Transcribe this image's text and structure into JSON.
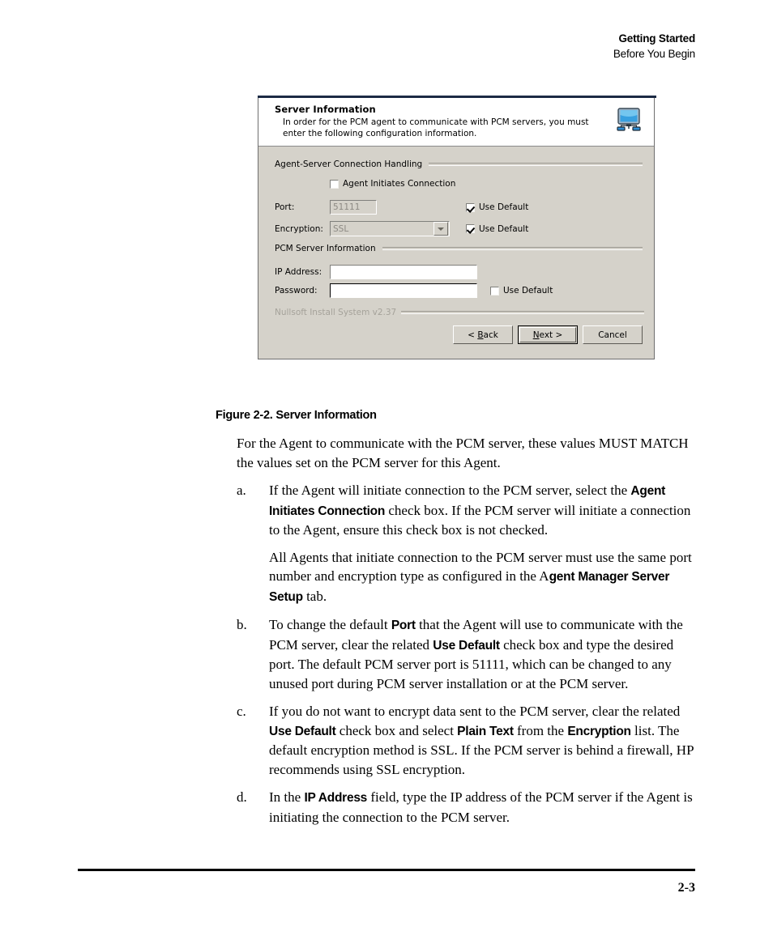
{
  "header": {
    "title": "Getting Started",
    "subtitle": "Before You Begin"
  },
  "dialog": {
    "head_title": "Server Information",
    "head_desc": "In order for the PCM agent to communicate with PCM servers, you must enter the following configuration information.",
    "head_icon": "network-monitor-icon",
    "group_connection": "Agent-Server Connection Handling",
    "agent_initiates_label": "Agent Initiates Connection",
    "agent_initiates_checked": false,
    "port_label": "Port:",
    "port_value": "51111",
    "port_use_default_label": "Use Default",
    "port_use_default_checked": true,
    "encryption_label": "Encryption:",
    "encryption_value": "SSL",
    "encryption_use_default_label": "Use Default",
    "encryption_use_default_checked": true,
    "group_server": "PCM Server Information",
    "ip_label": "IP Address:",
    "ip_value": "",
    "password_label": "Password:",
    "password_value": "",
    "password_use_default_label": "Use Default",
    "password_use_default_checked": false,
    "brand": "Nullsoft Install System v2.37",
    "btn_back": "< Back",
    "btn_back_accel": "B",
    "btn_next": "Next >",
    "btn_next_accel": "N",
    "btn_cancel": "Cancel",
    "accent_icon_color": "#2f8fd6"
  },
  "figure": {
    "caption": "Figure 2-2. Server Information"
  },
  "body": {
    "intro": "For the Agent to communicate with the PCM server, these values MUST MATCH the values set on the PCM server for this Agent.",
    "items": [
      {
        "marker": "a.",
        "paragraphs": [
          {
            "runs": [
              {
                "t": "If the Agent will initiate connection to the PCM server, select the ",
                "b": false
              },
              {
                "t": "Agent Initiates Connection",
                "b": true
              },
              {
                "t": " check box. If the PCM server will initiate a connection to the Agent, ensure this check box is not checked.",
                "b": false
              }
            ]
          },
          {
            "runs": [
              {
                "t": "All Agents that initiate connection to the PCM server must use the same port number and encryption type as configured in the A",
                "b": false
              },
              {
                "t": "gent Manager Server Setup",
                "b": true
              },
              {
                "t": " tab.",
                "b": false
              }
            ]
          }
        ]
      },
      {
        "marker": "b.",
        "paragraphs": [
          {
            "runs": [
              {
                "t": "To change the default ",
                "b": false
              },
              {
                "t": "Port",
                "b": true
              },
              {
                "t": " that the Agent will use to communicate with the PCM server, clear the related ",
                "b": false
              },
              {
                "t": "Use Default",
                "b": true
              },
              {
                "t": " check box and type the desired port. The default PCM server port is 51111, which can be changed to any unused port during PCM server installation or at the PCM server.",
                "b": false
              }
            ]
          }
        ]
      },
      {
        "marker": "c.",
        "paragraphs": [
          {
            "runs": [
              {
                "t": "If you do not want to encrypt data sent to the PCM server, clear the related ",
                "b": false
              },
              {
                "t": "Use Default",
                "b": true
              },
              {
                "t": " check box and select ",
                "b": false
              },
              {
                "t": "Plain Text",
                "b": true
              },
              {
                "t": " from the ",
                "b": false
              },
              {
                "t": "Encryption",
                "b": true
              },
              {
                "t": " list. The default encryption method is SSL. If the PCM server is behind a firewall, HP recommends using SSL encryption.",
                "b": false
              }
            ]
          }
        ]
      },
      {
        "marker": "d.",
        "paragraphs": [
          {
            "runs": [
              {
                "t": "In the ",
                "b": false
              },
              {
                "t": "IP Address",
                "b": true
              },
              {
                "t": " field, type the IP address of the PCM server if the Agent is initiating the connection to the PCM server.",
                "b": false
              }
            ]
          }
        ]
      }
    ]
  },
  "footer": {
    "page_number": "2-3"
  }
}
